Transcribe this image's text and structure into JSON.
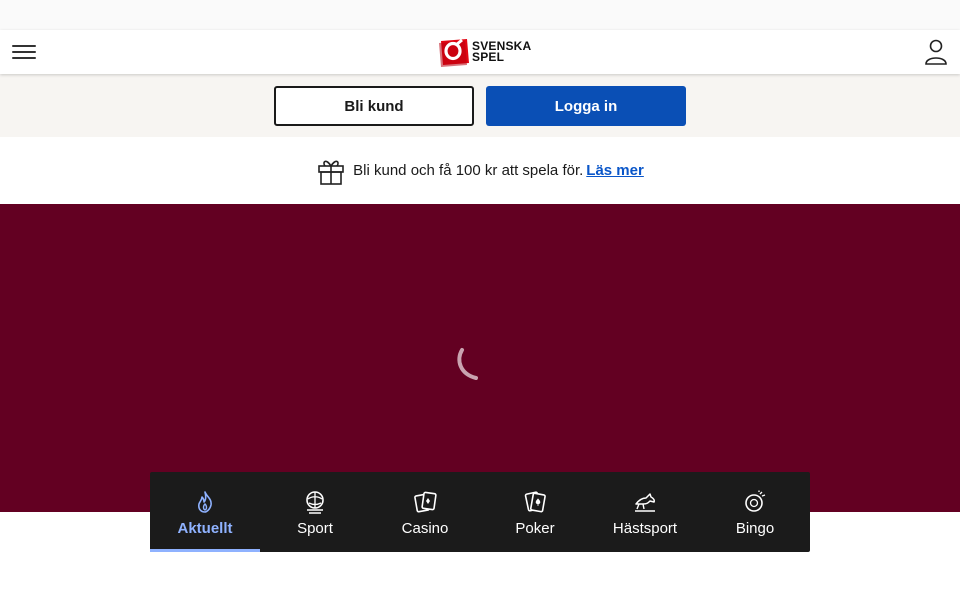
{
  "header": {
    "menu_icon": "hamburger-menu-icon",
    "logo_line1": "SVENSKA",
    "logo_line2": "SPEL",
    "user_icon": "user-icon"
  },
  "auth": {
    "register_label": "Bli kund",
    "login_label": "Logga in"
  },
  "promo": {
    "icon": "gift-icon",
    "text": "Bli kund och få 100 kr att spela för.",
    "link_label": "Läs mer"
  },
  "hero": {
    "state": "loading",
    "spinner_icon": "loading-spinner-icon"
  },
  "nav": {
    "items": [
      {
        "label": "Aktuellt",
        "icon": "flame-icon",
        "active": true
      },
      {
        "label": "Sport",
        "icon": "sports-ball-icon",
        "active": false
      },
      {
        "label": "Casino",
        "icon": "casino-cards-icon",
        "active": false
      },
      {
        "label": "Poker",
        "icon": "poker-cards-icon",
        "active": false
      },
      {
        "label": "Hästsport",
        "icon": "horse-icon",
        "active": false
      },
      {
        "label": "Bingo",
        "icon": "bingo-ball-icon",
        "active": false
      }
    ]
  },
  "colors": {
    "brand_red": "#e30613",
    "login_blue": "#0a4fb5",
    "hero_bg": "#630022",
    "nav_bg": "#1b1b1b",
    "nav_active": "#8fb2ff",
    "link_blue": "#0a56c9"
  }
}
